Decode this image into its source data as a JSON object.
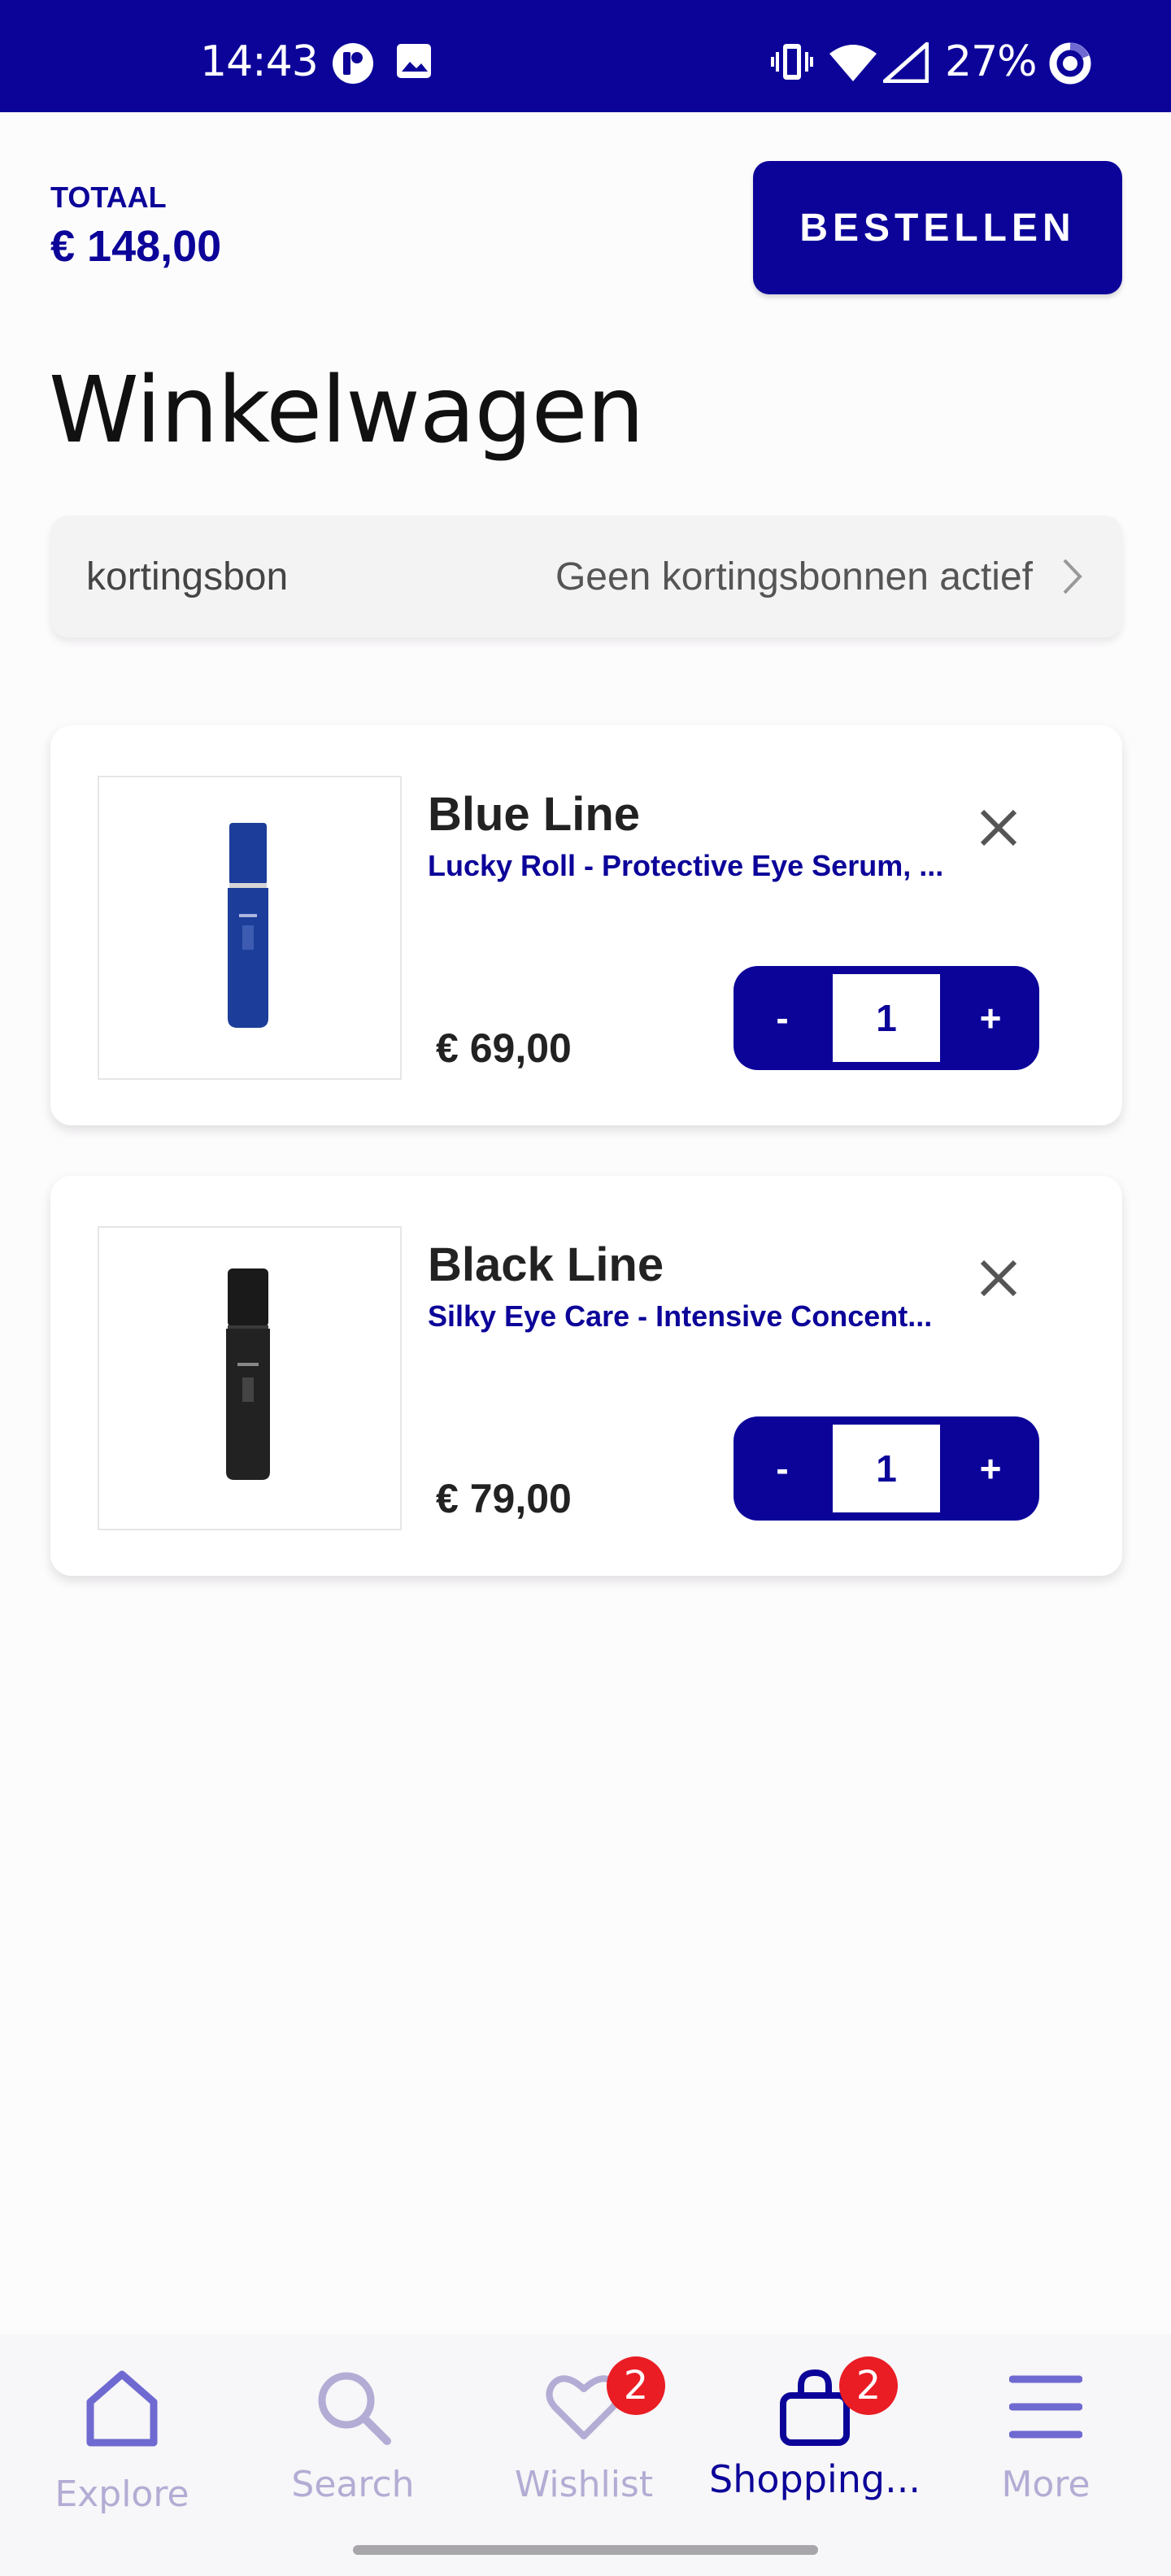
{
  "status_bar": {
    "time": "14:43",
    "battery": "27%",
    "icons": [
      "app-notification-icon",
      "image-icon",
      "vibrate-icon",
      "wifi-icon",
      "signal-icon",
      "battery-ring-icon"
    ]
  },
  "header": {
    "total_label": "TOTAAL",
    "total_value": "€ 148,00",
    "order_button": "BESTELLEN"
  },
  "page_title": "Winkelwagen",
  "coupon": {
    "label": "kortingsbon",
    "value": "Geen kortingsbonnen actief"
  },
  "cart_items": [
    {
      "brand": "Blue Line",
      "name": "Lucky Roll - Protective Eye Serum, ...",
      "price": "€ 69,00",
      "quantity": "1",
      "minus": "-",
      "plus": "+",
      "product_color": "#1c3e9a"
    },
    {
      "brand": "Black Line",
      "name": "Silky Eye Care - Intensive Concent...",
      "price": "€ 79,00",
      "quantity": "1",
      "minus": "-",
      "plus": "+",
      "product_color": "#1a1a1a"
    }
  ],
  "bottom_nav": {
    "items": [
      {
        "label": "Explore",
        "icon": "home-icon",
        "active": false
      },
      {
        "label": "Search",
        "icon": "search-icon",
        "active": false
      },
      {
        "label": "Wishlist",
        "icon": "heart-icon",
        "active": false,
        "badge": "2"
      },
      {
        "label": "Shopping...",
        "icon": "shopping-bag-icon",
        "active": true,
        "badge": "2"
      },
      {
        "label": "More",
        "icon": "menu-icon",
        "active": false
      }
    ]
  },
  "colors": {
    "brand": "#0c0499",
    "badge": "#ea1c24",
    "inactive_nav": "#b3acd4"
  }
}
